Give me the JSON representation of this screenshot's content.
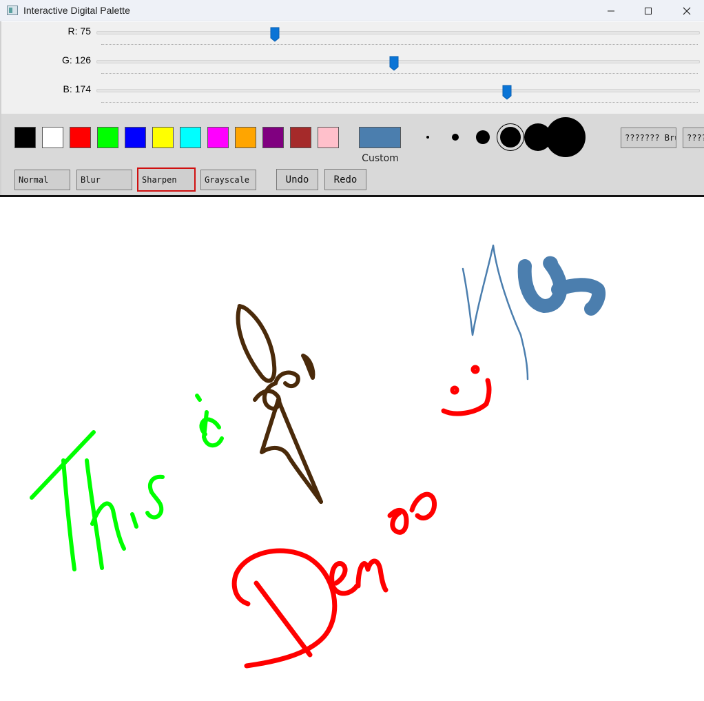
{
  "window": {
    "title": "Interactive Digital Palette"
  },
  "sliders": [
    {
      "label": "R: 75",
      "value": 75,
      "max": 255
    },
    {
      "label": "G: 126",
      "value": 126,
      "max": 255
    },
    {
      "label": "B: 174",
      "value": 174,
      "max": 255
    }
  ],
  "palette": {
    "colors": [
      "#000000",
      "#ffffff",
      "#ff0000",
      "#00ff00",
      "#0000ff",
      "#ffff00",
      "#00ffff",
      "#ff00ff",
      "#ffa500",
      "#800080",
      "#a52a2a",
      "#ffc0cb"
    ],
    "custom_color": "#4b7eae",
    "custom_label": "Custom"
  },
  "brush_sizes": {
    "count": 6,
    "selected_index": 3
  },
  "brush_buttons": {
    "first": "??????? Brus",
    "second": "????"
  },
  "filters": {
    "normal": "Normal",
    "blur": "Blur",
    "sharpen": "Sharpen",
    "grayscale": "Grayscale",
    "selected": "sharpen"
  },
  "history": {
    "undo": "Undo",
    "redo": "Redo"
  },
  "drawing": {
    "accent_colors": {
      "green": "#00ff00",
      "brown": "#4a2a0a",
      "red": "#ff0000",
      "blue": "#4b7eae"
    }
  }
}
